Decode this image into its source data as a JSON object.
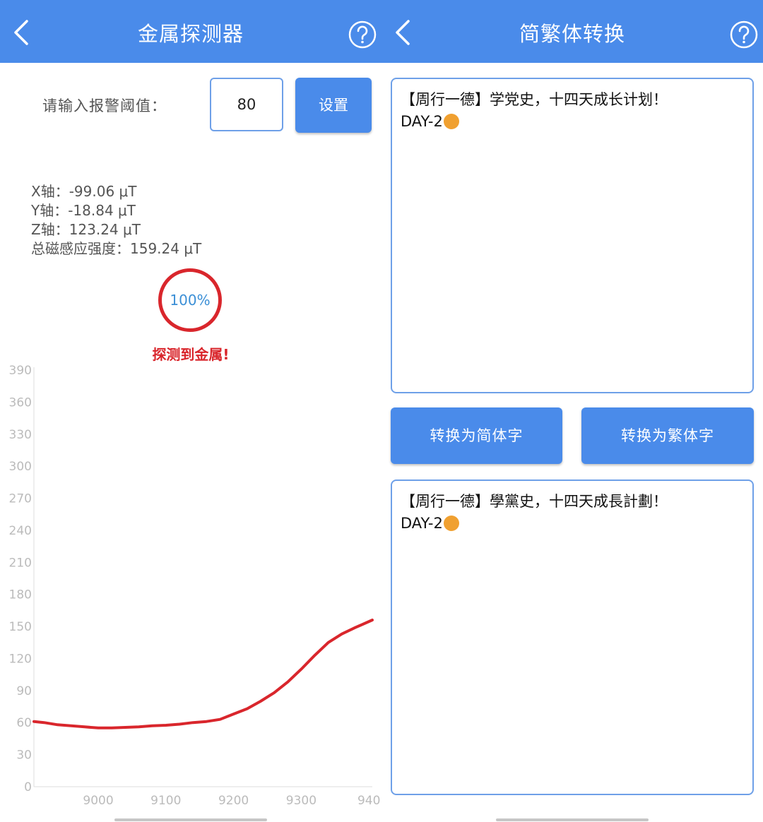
{
  "left": {
    "title": "金属探测器",
    "threshold_label": "请输入报警阈值：",
    "threshold_value": "80",
    "set_button": "设置",
    "readings": {
      "x": "X轴：-99.06 μT",
      "y": "Y轴：-18.84 μT",
      "z": "Z轴：123.24 μT",
      "total": "总磁感应强度：159.24 μT"
    },
    "gauge_percent": "100%",
    "status": "探测到金属!",
    "status_color": "#d9262c"
  },
  "right": {
    "title": "简繁体转换",
    "input_line1": "【周行一德】学党史，十四天成长计划！",
    "input_line2": "DAY-2",
    "button_simplified": "转换为简体字",
    "button_traditional": "转换为繁体字",
    "output_line1": "【周行一德】學黨史，十四天成長計劃！",
    "output_line2": "DAY-2"
  },
  "icons": {
    "back": "chevron-left-icon",
    "help": "question-circle-icon",
    "emoji": "person-raising-hand-emoji"
  },
  "colors": {
    "primary": "#4a8bea",
    "alert": "#d9262c",
    "gauge_text": "#3b8fd6"
  },
  "chart_data": {
    "type": "line",
    "xlabel": "",
    "ylabel": "",
    "ylim": [
      0,
      390
    ],
    "xlim": [
      8905,
      9405
    ],
    "y_ticks": [
      "390",
      "360",
      "330",
      "300",
      "270",
      "240",
      "210",
      "180",
      "150",
      "120",
      "90",
      "60",
      "30",
      "0"
    ],
    "x_ticks": [
      "9000",
      "9100",
      "9200",
      "9300",
      "940"
    ],
    "series": [
      {
        "color": "#d9262c",
        "points": [
          [
            8905,
            61
          ],
          [
            8920,
            60
          ],
          [
            8940,
            58
          ],
          [
            8960,
            57
          ],
          [
            8980,
            56
          ],
          [
            9000,
            55
          ],
          [
            9020,
            55
          ],
          [
            9040,
            55.5
          ],
          [
            9060,
            56
          ],
          [
            9080,
            57
          ],
          [
            9100,
            57.5
          ],
          [
            9120,
            58.5
          ],
          [
            9140,
            60
          ],
          [
            9160,
            61
          ],
          [
            9180,
            63
          ],
          [
            9200,
            68
          ],
          [
            9220,
            73
          ],
          [
            9240,
            80
          ],
          [
            9260,
            88
          ],
          [
            9280,
            98
          ],
          [
            9300,
            110
          ],
          [
            9320,
            123
          ],
          [
            9340,
            135
          ],
          [
            9360,
            143
          ],
          [
            9380,
            149
          ],
          [
            9405,
            156
          ]
        ]
      }
    ]
  }
}
